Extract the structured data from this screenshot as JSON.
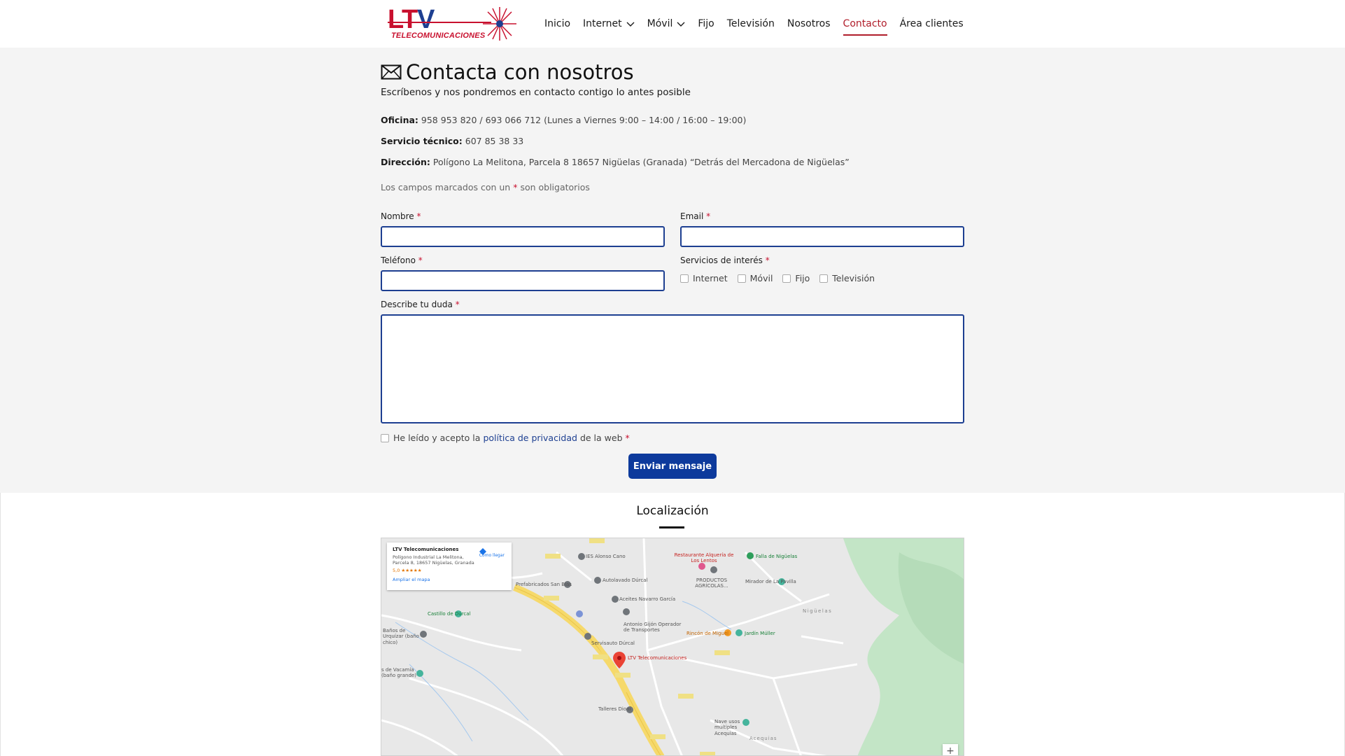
{
  "brand": {
    "logo_letters": "LTV",
    "logo_sub": "TELECOMUNICACIONES",
    "colors": {
      "red": "#c8102e",
      "blue": "#1d3f91",
      "button": "#0d3a9c"
    }
  },
  "nav": {
    "items": [
      {
        "label": "Inicio",
        "dropdown": false
      },
      {
        "label": "Internet",
        "dropdown": true
      },
      {
        "label": "Móvil",
        "dropdown": true
      },
      {
        "label": "Fijo",
        "dropdown": false
      },
      {
        "label": "Televisión",
        "dropdown": false
      },
      {
        "label": "Nosotros",
        "dropdown": false
      },
      {
        "label": "Contacto",
        "dropdown": false,
        "active": true
      },
      {
        "label": "Área clientes",
        "dropdown": false
      }
    ]
  },
  "contact": {
    "icon": "envelope-icon",
    "title": "Contacta con nosotros",
    "subtitle": "Escríbenos y nos pondremos en contacto contigo lo antes posible",
    "office_label": "Oficina:",
    "office_value": "958 953 820 / 693 066 712 (Lunes a Viernes 9:00 – 14:00 / 16:00 – 19:00)",
    "tech_label": "Servicio técnico:",
    "tech_value": "607 85 38 33",
    "address_label": "Dirección:",
    "address_value": "Polígono La Melitona, Parcela 8 18657 Nigüelas (Granada) “Detrás del Mercadona de Nigüelas”",
    "required_pre": "Los campos marcados con un",
    "required_star": "*",
    "required_post": "son obligatorios"
  },
  "form": {
    "name_label": "Nombre",
    "email_label": "Email",
    "phone_label": "Teléfono",
    "services_label": "Servicios de interés",
    "question_label": "Describe tu duda",
    "star": "*",
    "services": [
      "Internet",
      "Móvil",
      "Fijo",
      "Televisión"
    ],
    "privacy_pre": "He leído y acepto la",
    "privacy_link": "política de privacidad",
    "privacy_post": "de la web",
    "submit": "Enviar mensaje"
  },
  "location": {
    "title": "Localización",
    "card": {
      "name": "LTV Telecomunicaciones",
      "address_1": "Polígono Industrial La Melitona,",
      "address_2": "Parcela 8, 18657 Nigüelas, Granada",
      "rating": "5,0 ★★★★★",
      "enlarge": "Ampliar el mapa",
      "directions": "Cómo llegar"
    },
    "labels": [
      "IES Alonso Cano",
      "Prefabricados San Blas",
      "Autolavado Dúrcal",
      "Aceites Navarro García",
      "Castillo de Dúrcal",
      "Antonio Gijón Operador de Transportes",
      "Baños de Urquízar (baño chico)",
      "Servisauto Dúrcal",
      "LTV Telecomunicaciones",
      "Restaurante Alquería de Los Lentos",
      "Falla de Nigüelas",
      "PRODUCTOS AGRÍCOLAS...",
      "Mirador de La Pavilla",
      "Nigüelas",
      "Rincón de Miguel",
      "Jardín Múller",
      "Talleres Dioni",
      "Nave usos múltiples Acequias",
      "Acequias",
      "s de Vacamía (baño grande)"
    ],
    "zoom_in": "+"
  }
}
